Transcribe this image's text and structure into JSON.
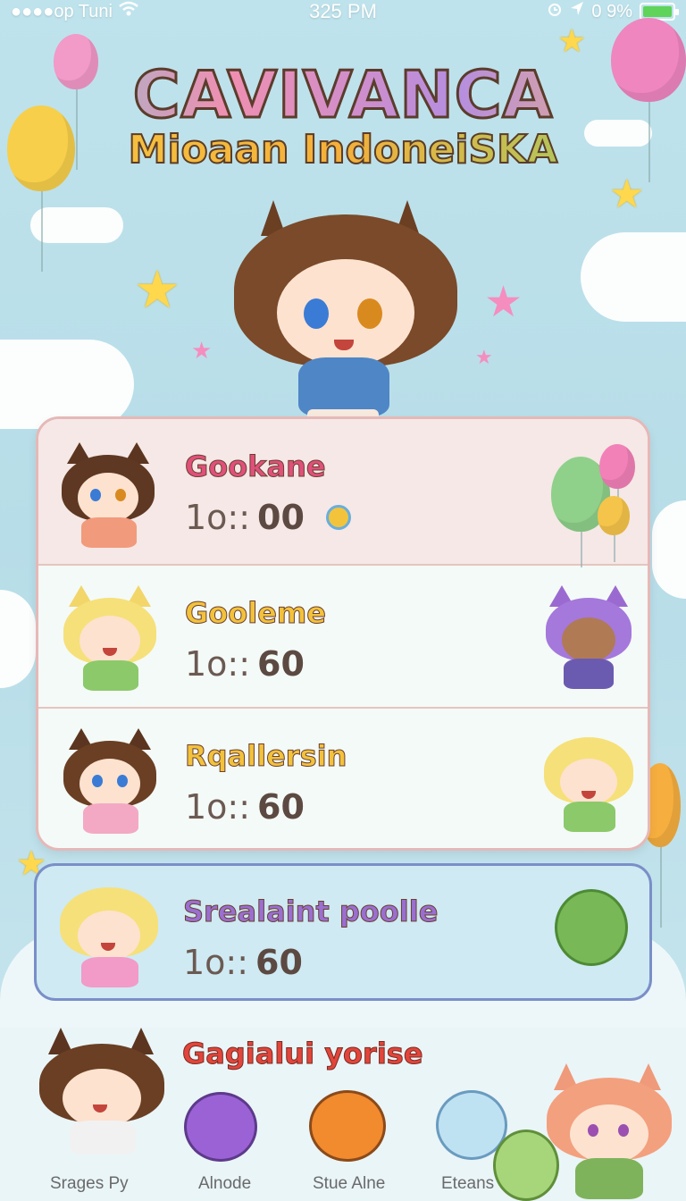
{
  "status_bar": {
    "carrier": "●●●●op Tuni",
    "time": "325 PM",
    "battery": "0 9%"
  },
  "title": {
    "main": "CAVIVANCA",
    "sub": "Mioaan IndoneiSKA"
  },
  "leaderboard": [
    {
      "name": "Gookane",
      "prefix": "1o::",
      "score": "00",
      "name_color": "#e0507a"
    },
    {
      "name": "Gooleme",
      "prefix": "1o::",
      "score": "60",
      "name_color": "#f3c23c"
    },
    {
      "name": "Rqallersin",
      "prefix": "1o::",
      "score": "60",
      "name_color": "#f3c23c"
    }
  ],
  "highlight_card": {
    "name": "Srealaint poolle",
    "prefix": "1o::",
    "score": "60",
    "name_color": "#9a6fd0"
  },
  "bottom_section": {
    "title": "Gagialui yorise",
    "tabs": [
      "Srages Py",
      "Alnode",
      "Stue Alne",
      "Eteans"
    ]
  },
  "icons": [
    "wifi-icon",
    "alarm-icon",
    "location-icon",
    "battery-icon",
    "coin-icon"
  ]
}
